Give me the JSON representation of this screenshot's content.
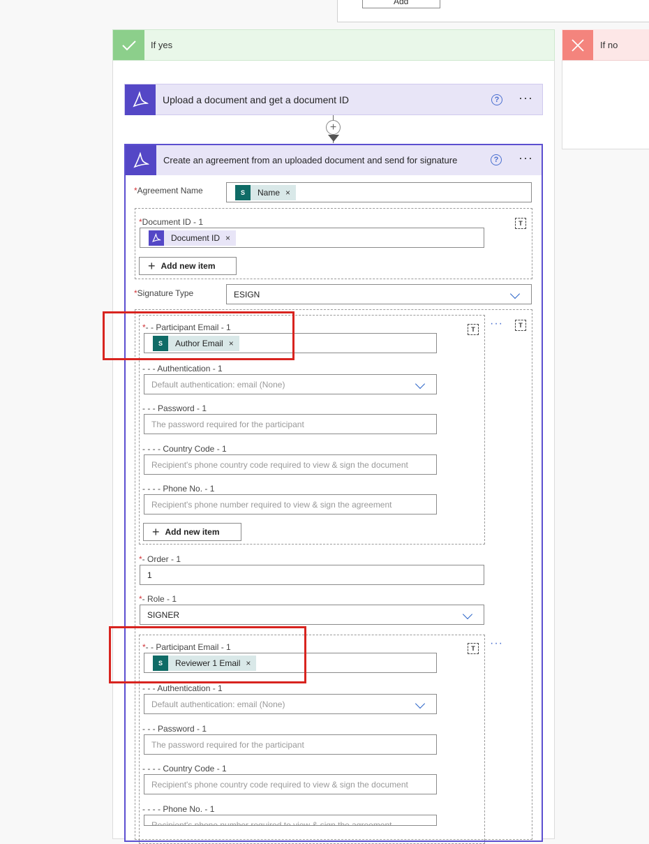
{
  "top": {
    "add_label": "Add"
  },
  "branches": {
    "yes_label": "If yes",
    "no_label": "If no"
  },
  "action1": {
    "title": "Upload a document and get a document ID",
    "help": "?",
    "more": "···"
  },
  "action2": {
    "title": "Create an agreement from an uploaded document and send for signature",
    "help": "?",
    "more": "···"
  },
  "form": {
    "agreement_name": {
      "label": "Agreement Name",
      "token": "Name"
    },
    "document_id": {
      "label": "Document ID - 1",
      "token": "Document ID"
    },
    "add_new_item": "Add new item",
    "signature_type": {
      "label": "Signature Type",
      "value": "ESIGN"
    },
    "participant1": {
      "email_label": "- - Participant Email - 1",
      "email_token": "Author Email",
      "auth_label": "- - - Authentication - 1",
      "auth_placeholder": "Default authentication: email (None)",
      "password_label": "- - - Password - 1",
      "password_placeholder": "The password required for the participant",
      "country_label": "- - - - Country Code - 1",
      "country_placeholder": "Recipient's phone country code required to view & sign the document",
      "phone_label": "- - - - Phone No. - 1",
      "phone_placeholder": "Recipient's phone number required to view & sign the agreement",
      "add_new_item": "Add new item"
    },
    "order": {
      "label": "- Order - 1",
      "value": "1"
    },
    "role": {
      "label": "- Role - 1",
      "value": "SIGNER"
    },
    "participant2": {
      "email_label": "- - Participant Email - 1",
      "email_token": "Reviewer 1 Email",
      "auth_label": "- - - Authentication - 1",
      "auth_placeholder": "Default authentication: email (None)",
      "password_label": "- - - Password - 1",
      "password_placeholder": "The password required for the participant",
      "country_label": "- - - - Country Code - 1",
      "country_placeholder": "Recipient's phone country code required to view & sign the document",
      "phone_label": "- - - - Phone No. - 1",
      "phone_placeholder": "Recipient's phone number required to view & sign the agreement"
    }
  },
  "icons": {
    "sharepoint_text": "S",
    "required_mark": "*",
    "remove": "×",
    "delete_text": "T"
  },
  "colors": {
    "adobe_purple": "#5447c6",
    "sharepoint_teal": "#0f6b66",
    "yes_green": "#8ccf8b",
    "no_red": "#f4847d",
    "highlight_red": "#d8241f"
  }
}
